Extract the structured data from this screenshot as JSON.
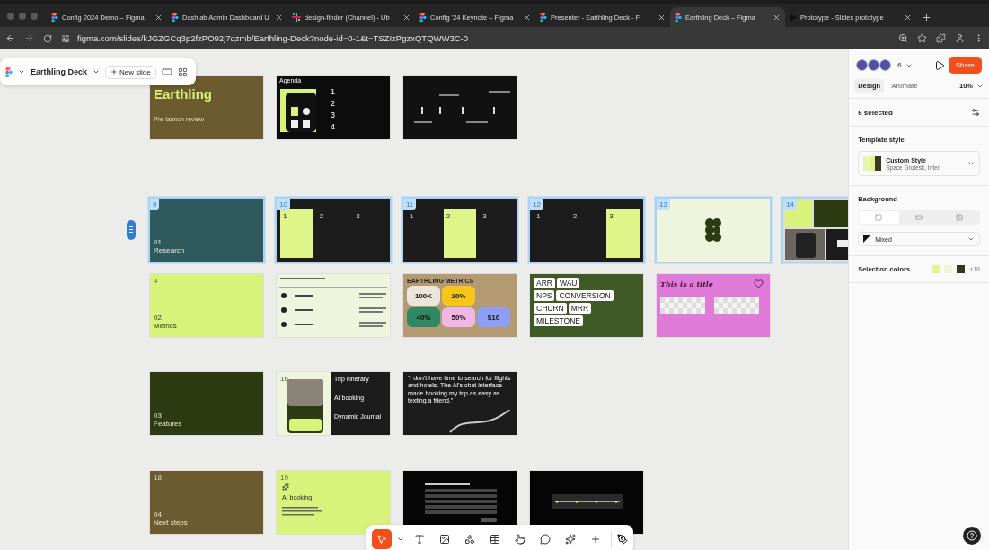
{
  "browser": {
    "tabs": [
      {
        "kind": "figma",
        "title": "Config 2024 Demo – Figma",
        "selected": false
      },
      {
        "kind": "figma",
        "title": "Dashlab Admin Dashboard U",
        "selected": false
      },
      {
        "kind": "slack",
        "title": "design-finder (Channel) - Ub",
        "selected": false
      },
      {
        "kind": "figma",
        "title": "Config '24 Keynote – Figma",
        "selected": false
      },
      {
        "kind": "figma",
        "title": "Presenter - Earthling Deck - F",
        "selected": false
      },
      {
        "kind": "figma",
        "title": "Earthling Deck – Figma",
        "selected": true
      },
      {
        "kind": "play",
        "title": "Prototype - Slides prototype",
        "selected": false
      }
    ],
    "url": "figma.com/slides/kJGZGCq3p2fzPO92j7qzmb/Earthling-Deck?node-id=0-1&t=TSZIzPgzxQTQWW3C-0"
  },
  "toolbar": {
    "file_name": "Earthling Deck",
    "new_slide": "New slide"
  },
  "slide_rows": [
    [
      {
        "kind": "title",
        "color": "#6b5b2e",
        "title": "Earthling",
        "subtitle": "Pre-launch review",
        "selected": false
      },
      {
        "kind": "agenda",
        "heading": "Agenda",
        "items": [
          "1",
          "2",
          "3",
          "4"
        ],
        "selected": false
      },
      {
        "kind": "timeline",
        "selected": false
      }
    ],
    [
      {
        "kind": "section",
        "number": "9",
        "color": "#2e5a5e",
        "index": "01",
        "title": "Research",
        "selected": true
      },
      {
        "kind": "cards",
        "number": "10",
        "selected": true,
        "cards": [
          {
            "label": "1",
            "highlighted": true
          },
          {
            "label": "2",
            "highlighted": false
          },
          {
            "label": "3",
            "highlighted": false
          }
        ]
      },
      {
        "kind": "cards",
        "number": "11",
        "selected": true,
        "cards": [
          {
            "label": "1",
            "highlighted": false
          },
          {
            "label": "2",
            "highlighted": true
          },
          {
            "label": "3",
            "highlighted": false
          }
        ]
      },
      {
        "kind": "cards",
        "number": "12",
        "selected": true,
        "cards": [
          {
            "label": "1",
            "highlighted": false
          },
          {
            "label": "2",
            "highlighted": false
          },
          {
            "label": "3",
            "highlighted": true
          }
        ]
      },
      {
        "kind": "logo",
        "number": "13",
        "selected": true
      },
      {
        "kind": "collage",
        "number": "14",
        "selected": true
      }
    ],
    [
      {
        "kind": "section",
        "number": "4",
        "color": "#d8f27a",
        "index": "02",
        "title": "Metrics",
        "selected": false
      },
      {
        "kind": "list",
        "selected": false
      },
      {
        "kind": "metrics",
        "title": "EARTHLING METRICS",
        "selected": false,
        "tiles": [
          [
            {
              "value": "100K",
              "color": "#ece6da"
            },
            {
              "value": "20%",
              "color": "#f5c518"
            }
          ],
          [
            {
              "value": "40%",
              "color": "#2f8a63"
            },
            {
              "value": "50%",
              "color": "#f0b6e6"
            },
            {
              "value": "$10",
              "color": "#8c9ef5"
            }
          ]
        ]
      },
      {
        "kind": "tags",
        "selected": false,
        "tags": [
          [
            "ARR",
            "WAU"
          ],
          [
            "NPS",
            "CONVERSION"
          ],
          [
            "CHURN",
            "MRR"
          ],
          [
            "MILESTONE"
          ]
        ]
      },
      {
        "kind": "template",
        "title": "This is a title",
        "selected": false
      }
    ],
    [
      {
        "kind": "section",
        "color": "#2e3a12",
        "index": "03",
        "title": "Features",
        "selected": false
      },
      {
        "kind": "features",
        "number": "16",
        "selected": false,
        "items": [
          "Trip itinerary",
          "AI booking",
          "Dynamic Journal"
        ]
      },
      {
        "kind": "quote",
        "text": "“I don't have time to search for flights and hotels. The AI's chat interface made booking my trip as easy as texting a friend.”",
        "selected": false
      }
    ],
    [
      {
        "kind": "section",
        "number": "18",
        "color": "#6b5b2e",
        "index": "04",
        "title": "Next steps",
        "selected": false
      },
      {
        "kind": "feature",
        "number": "19",
        "title": "AI booking",
        "selected": false
      },
      {
        "kind": "form",
        "selected": false
      },
      {
        "kind": "rating",
        "selected": false
      }
    ]
  ],
  "bottom_tools": [
    {
      "kind": "move",
      "selected": true
    },
    {
      "kind": "text",
      "selected": false
    },
    {
      "kind": "image",
      "selected": false
    },
    {
      "kind": "shape",
      "selected": false
    },
    {
      "kind": "table",
      "selected": false
    },
    {
      "kind": "interactive",
      "selected": false
    },
    {
      "kind": "comment",
      "selected": false
    },
    {
      "kind": "ai",
      "selected": false
    },
    {
      "kind": "add",
      "selected": false
    }
  ],
  "panel": {
    "collaborator_count": "6",
    "share": "Share",
    "tabs": [
      {
        "label": "Design",
        "selected": true
      },
      {
        "label": "Animate",
        "selected": false
      }
    ],
    "zoom": "10%",
    "selection": "6 selected",
    "template_style": {
      "heading": "Template style",
      "name": "Custom Style",
      "fonts": "Space Grotesk, Inter"
    },
    "background": {
      "heading": "Background",
      "modes": [
        {
          "kind": "solid",
          "selected": true
        },
        {
          "kind": "gradient",
          "selected": false
        },
        {
          "kind": "image",
          "selected": false
        }
      ],
      "fill": "Mixed"
    },
    "selection_colors": {
      "heading": "Selection colors",
      "swatches": [
        {
          "color": "#dff58a"
        },
        {
          "color": "#eef5dc"
        },
        {
          "color": "#2f3a1a"
        }
      ],
      "more": "+18"
    }
  }
}
